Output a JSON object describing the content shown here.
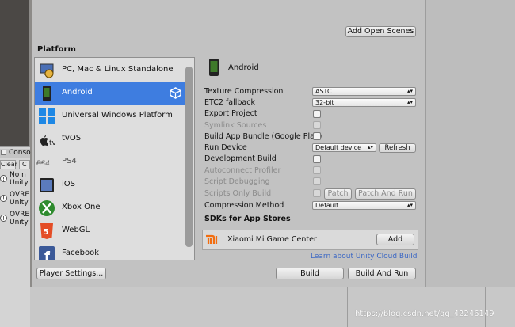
{
  "window": {
    "add_open_scenes": "Add Open Scenes",
    "platform_header": "Platform",
    "player_settings": "Player Settings...",
    "build": "Build",
    "build_and_run": "Build And Run"
  },
  "platforms": [
    {
      "label": "PC, Mac & Linux Standalone",
      "icon": "pc-icon",
      "selected": false
    },
    {
      "label": "Android",
      "icon": "android-icon",
      "selected": true
    },
    {
      "label": "Universal Windows Platform",
      "icon": "windows-icon",
      "selected": false
    },
    {
      "label": "tvOS",
      "icon": "apple-tv-icon",
      "selected": false
    },
    {
      "label": "PS4",
      "icon": "ps4-icon",
      "selected": false
    },
    {
      "label": "iOS",
      "icon": "ios-icon",
      "selected": false
    },
    {
      "label": "Xbox One",
      "icon": "xbox-icon",
      "selected": false
    },
    {
      "label": "WebGL",
      "icon": "html5-icon",
      "selected": false
    },
    {
      "label": "Facebook",
      "icon": "facebook-icon",
      "selected": false
    }
  ],
  "settings": {
    "title": "Android",
    "texture_compression_label": "Texture Compression",
    "texture_compression_value": "ASTC",
    "etc2_label": "ETC2 fallback",
    "etc2_value": "32-bit",
    "export_project": "Export Project",
    "symlink_sources": "Symlink Sources",
    "build_app_bundle": "Build App Bundle (Google Play)",
    "run_device_label": "Run Device",
    "run_device_value": "Default device",
    "refresh": "Refresh",
    "development_build": "Development Build",
    "autoconnect_profiler": "Autoconnect Profiler",
    "script_debugging": "Script Debugging",
    "scripts_only_build": "Scripts Only Build",
    "patch": "Patch",
    "patch_and_run": "Patch And Run",
    "compression_label": "Compression Method",
    "compression_value": "Default",
    "sdk_header": "SDKs for App Stores",
    "sdk_name": "Xiaomi Mi Game Center",
    "add": "Add",
    "cloud_link": "Learn about Unity Cloud Build"
  },
  "console": {
    "tab": "Conso",
    "clear": "Clear",
    "c": "C",
    "rows": [
      {
        "line1": "No n",
        "line2": "Unity"
      },
      {
        "line1": "OVRE",
        "line2": "Unity"
      },
      {
        "line1": "OVRE",
        "line2": "Unity"
      }
    ]
  },
  "watermark": "https://blog.csdn.net/qq_42246149",
  "colors": {
    "selection": "#3e7de0",
    "link": "#3b67c4"
  }
}
